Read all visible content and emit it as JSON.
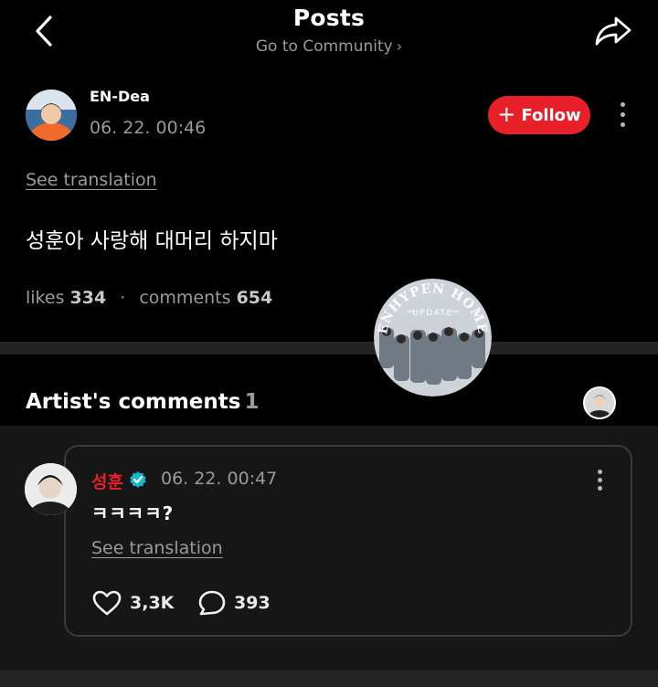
{
  "header": {
    "title": "Posts",
    "community_link": "Go to Community",
    "back_icon": "chevron-left-icon",
    "share_icon": "share-icon"
  },
  "post": {
    "author": "EN-Dea",
    "timestamp": "06. 22. 00:46",
    "follow_label": "Follow",
    "see_translation": "See translation",
    "text": "성훈아 사랑해 대머리 하지마",
    "likes_label": "likes",
    "likes_count": "334",
    "comments_label": "comments",
    "comments_count": "654"
  },
  "artist_comments": {
    "title": "Artist's comments",
    "count": "1",
    "comment": {
      "author": "성훈",
      "verified": true,
      "timestamp": "06. 22. 00:47",
      "text": "ㅋㅋㅋㅋ?",
      "see_translation": "See translation",
      "likes": "3,3K",
      "replies": "393"
    }
  },
  "watermark": {
    "top_text": "ENHYPEN HOME",
    "sub_text": "UPDATE"
  },
  "colors": {
    "background": "#000000",
    "accent_red": "#e8202a",
    "verified_teal": "#19b8c8",
    "muted_text": "#9a9a9a",
    "card_bg": "#161616"
  }
}
